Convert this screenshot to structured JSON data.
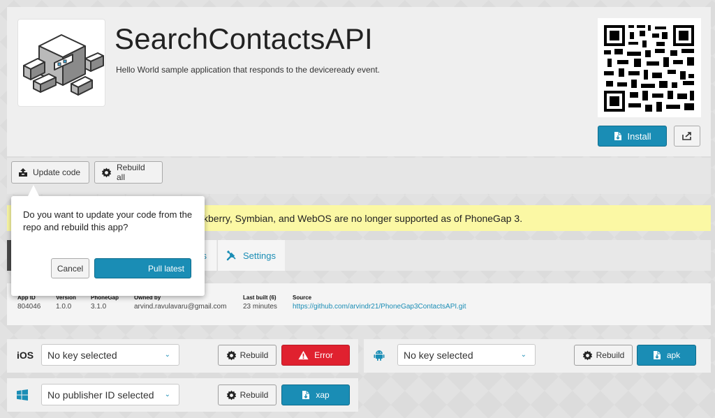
{
  "app": {
    "title": "SearchContactsAPI",
    "description": "Hello World sample application that responds to the deviceready event."
  },
  "header_actions": {
    "install_label": "Install",
    "install_icon": "file-download-icon",
    "share_icon": "share-icon"
  },
  "toolbar": {
    "update_code_label": "Update code",
    "rebuild_all_label": "Rebuild all"
  },
  "notice": {
    "text": "kberry, Symbian, and WebOS are no longer supported as of PhoneGap 3."
  },
  "popover": {
    "message": "Do you want to update your code from the repo and rebuild this app?",
    "cancel_label": "Cancel",
    "pull_label": "Pull latest"
  },
  "tabs": {
    "fragment_label": "s",
    "settings_label": "Settings"
  },
  "info": {
    "app_id_label": "App ID",
    "app_id": "804046",
    "version_label": "Version",
    "version": "1.0.0",
    "phonegap_label": "PhoneGap",
    "phonegap": "3.1.0",
    "owned_by_label": "Owned by",
    "owned_by": "arvind.ravulavaru@gmail.com",
    "last_built_label": "Last built (6)",
    "last_built": "23 minutes",
    "source_label": "Source",
    "source": "https://github.com/arvindr21/PhoneGap3ContactsAPI.git"
  },
  "platforms": {
    "ios": {
      "label": "iOS",
      "key_value": "No key selected",
      "rebuild_label": "Rebuild",
      "status_label": "Error"
    },
    "android": {
      "key_value": "No key selected",
      "rebuild_label": "Rebuild",
      "download_label": "apk"
    },
    "windows": {
      "key_value": "No publisher ID selected",
      "rebuild_label": "Rebuild",
      "download_label": "xap"
    }
  },
  "colors": {
    "accent": "#1a8db5",
    "error": "#e0212f",
    "notice_bg": "#fbf8a4"
  }
}
